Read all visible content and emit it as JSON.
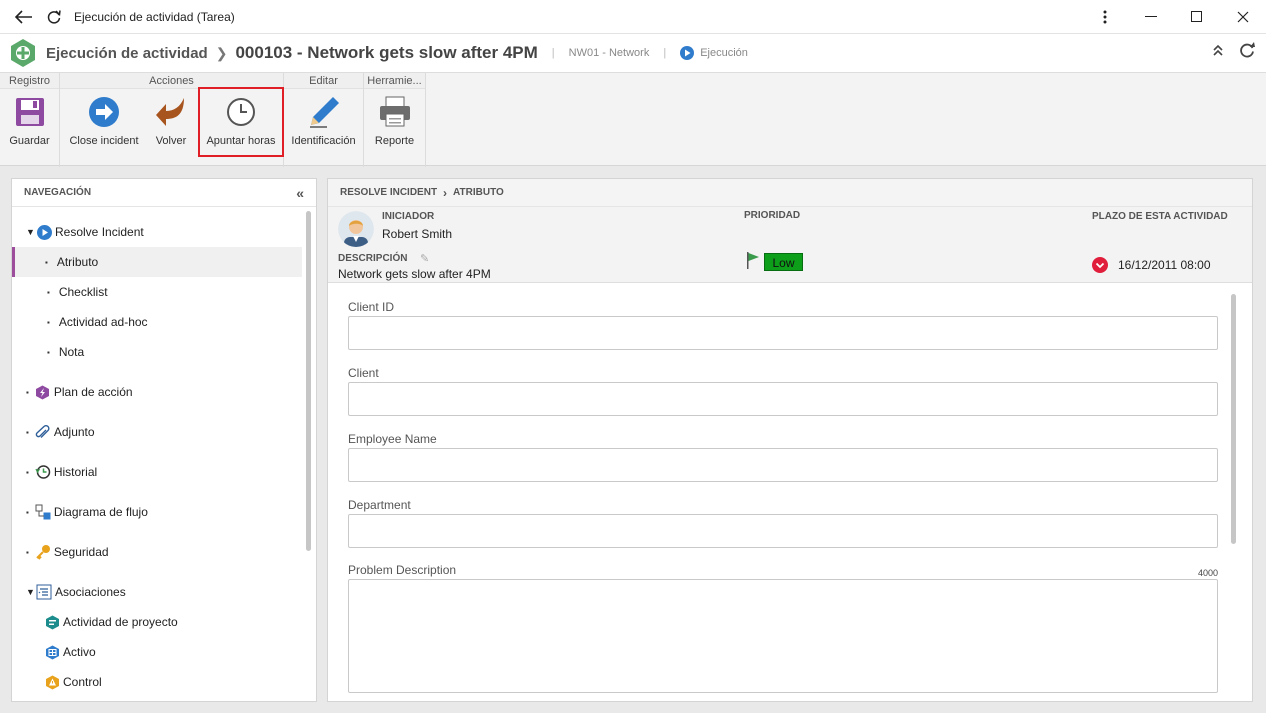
{
  "window": {
    "title": "Ejecución de actividad (Tarea)"
  },
  "header": {
    "module": "Ejecución de actividad",
    "record_title": "000103 - Network gets slow after 4PM",
    "category": "NW01 - Network",
    "status": "Ejecución"
  },
  "ribbon": {
    "groups": {
      "registro": "Registro",
      "acciones": "Acciones",
      "editar": "Editar",
      "herramientas": "Herramie..."
    },
    "buttons": {
      "guardar": "Guardar",
      "close_incident": "Close incident",
      "volver": "Volver",
      "apuntar_horas": "Apuntar horas",
      "identificacion": "Identificación",
      "reporte": "Reporte"
    }
  },
  "nav": {
    "title": "NAVEGACIÓN",
    "items": [
      {
        "label": "Resolve Incident"
      },
      {
        "label": "Atributo"
      },
      {
        "label": "Checklist"
      },
      {
        "label": "Actividad ad-hoc"
      },
      {
        "label": "Nota"
      },
      {
        "label": "Plan de acción"
      },
      {
        "label": "Adjunto"
      },
      {
        "label": "Historial"
      },
      {
        "label": "Diagrama de flujo"
      },
      {
        "label": "Seguridad"
      },
      {
        "label": "Asociaciones"
      },
      {
        "label": "Actividad de proyecto"
      },
      {
        "label": "Activo"
      },
      {
        "label": "Control"
      }
    ]
  },
  "main": {
    "breadcrumb": [
      "RESOLVE INCIDENT",
      "ATRIBUTO"
    ],
    "iniciador_label": "INICIADOR",
    "iniciador": "Robert Smith",
    "prioridad_label": "PRIORIDAD",
    "prioridad": "Low",
    "plazo_label": "PLAZO DE ESTA ACTIVIDAD",
    "plazo": "16/12/2011  08:00",
    "descripcion_label": "DESCRIPCIÓN",
    "descripcion": "Network gets slow after 4PM",
    "fields": {
      "client_id": "Client ID",
      "client": "Client",
      "employee_name": "Employee Name",
      "department": "Department",
      "problem_description": "Problem Description",
      "problem_description_max": "4000"
    }
  },
  "colors": {
    "accent_purple": "#9c4d9c",
    "priority_green": "#0d9e1a",
    "highlight_red": "#e01e26",
    "due_red": "#e01e3c"
  }
}
